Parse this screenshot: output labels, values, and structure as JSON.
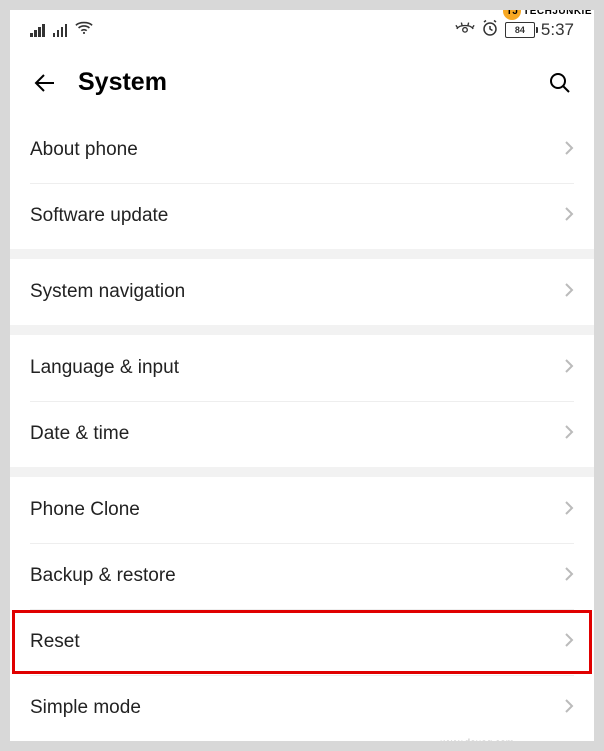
{
  "watermarks": {
    "top_brand": "TECHJUNKIE",
    "top_badge": "TJ",
    "bottom": "www.deuaq.com"
  },
  "statusbar": {
    "battery_level": "84",
    "time": "5:37"
  },
  "header": {
    "title": "System"
  },
  "groups": [
    {
      "items": [
        {
          "label": "About phone",
          "key": "about-phone"
        },
        {
          "label": "Software update",
          "key": "software-update"
        }
      ]
    },
    {
      "items": [
        {
          "label": "System navigation",
          "key": "system-navigation"
        }
      ]
    },
    {
      "items": [
        {
          "label": "Language & input",
          "key": "language-input"
        },
        {
          "label": "Date & time",
          "key": "date-time"
        }
      ]
    },
    {
      "items": [
        {
          "label": "Phone Clone",
          "key": "phone-clone"
        },
        {
          "label": "Backup & restore",
          "key": "backup-restore"
        },
        {
          "label": "Reset",
          "key": "reset",
          "highlighted": true
        },
        {
          "label": "Simple mode",
          "key": "simple-mode"
        }
      ]
    }
  ]
}
